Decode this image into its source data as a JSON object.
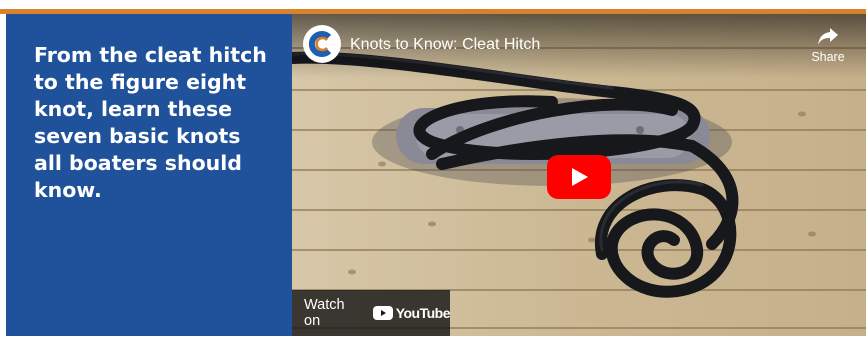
{
  "panel": {
    "headline": "From the cleat hitch to the figure eight knot, learn these seven basic knots all boaters should know."
  },
  "video": {
    "title": "Knots to Know: Cleat Hitch",
    "share_label": "Share",
    "watch_on_label": "Watch on",
    "youtube_wordmark": "YouTube",
    "icons": {
      "channel": "channel-logo-icon",
      "share": "share-arrow-icon",
      "play": "play-icon",
      "youtube": "youtube-logo-icon"
    }
  },
  "colors": {
    "accent_stripe": "#d9822b",
    "panel_blue": "#20529b",
    "play_red": "#ff0000"
  }
}
